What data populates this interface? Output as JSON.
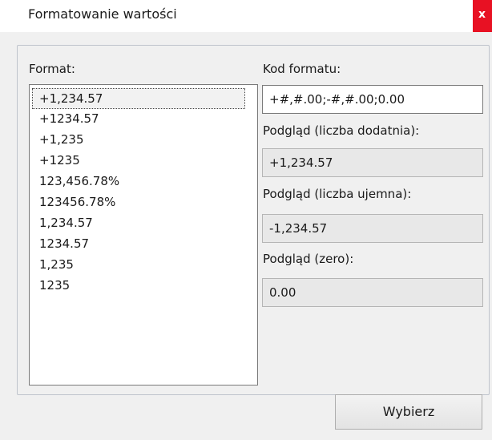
{
  "window": {
    "title": "Formatowanie wartości",
    "close_label": "x"
  },
  "format_list": {
    "label": "Format:",
    "items": [
      "+1,234.57",
      "+1234.57",
      "+1,235",
      "+1235",
      "123,456.78%",
      "123456.78%",
      "1,234.57",
      "1234.57",
      "1,235",
      "1235"
    ],
    "selected_index": 0
  },
  "format_code": {
    "label": "Kod formatu:",
    "value": "+#,#.00;-#,#.00;0.00"
  },
  "preview_positive": {
    "label": "Podgląd (liczba dodatnia):",
    "value": "+1,234.57"
  },
  "preview_negative": {
    "label": "Podgląd (liczba ujemna):",
    "value": "-1,234.57"
  },
  "preview_zero": {
    "label": "Podgląd (zero):",
    "value": "0.00"
  },
  "actions": {
    "select_label": "Wybierz"
  },
  "colors": {
    "close_button": "#e81123",
    "dialog_background": "#f0f0f0"
  }
}
